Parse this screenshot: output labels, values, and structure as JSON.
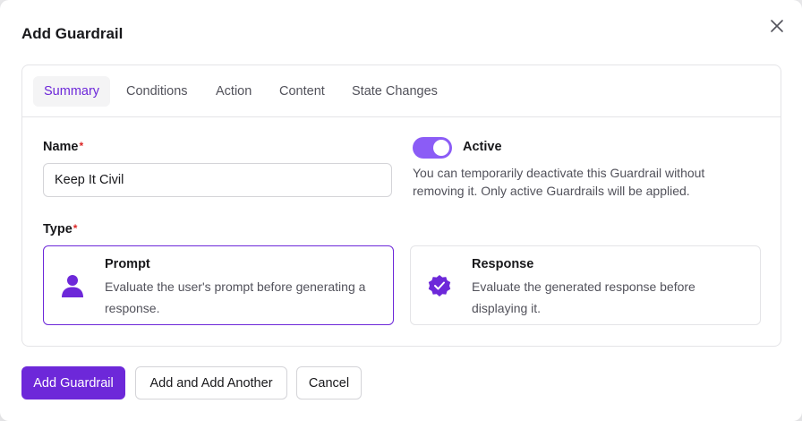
{
  "modal": {
    "title": "Add Guardrail"
  },
  "tabs": [
    {
      "label": "Summary",
      "active": true
    },
    {
      "label": "Conditions",
      "active": false
    },
    {
      "label": "Action",
      "active": false
    },
    {
      "label": "Content",
      "active": false
    },
    {
      "label": "State Changes",
      "active": false
    }
  ],
  "form": {
    "name_label": "Name",
    "required_mark": "*",
    "name_value": "Keep It Civil",
    "active_label": "Active",
    "active_on": true,
    "active_description": "You can temporarily deactivate this Guardrail without removing it. Only active Guardrails will be applied.",
    "type_label": "Type",
    "types": [
      {
        "title": "Prompt",
        "description": "Evaluate the user's prompt before generating a response.",
        "icon": "user-icon",
        "selected": true
      },
      {
        "title": "Response",
        "description": "Evaluate the generated response before displaying it.",
        "icon": "check-badge-icon",
        "selected": false
      }
    ]
  },
  "buttons": {
    "primary": "Add Guardrail",
    "add_another": "Add and Add Another",
    "cancel": "Cancel"
  },
  "colors": {
    "accent": "#6d28d9",
    "toggle": "#8b5cf6",
    "required": "#dc2626"
  }
}
